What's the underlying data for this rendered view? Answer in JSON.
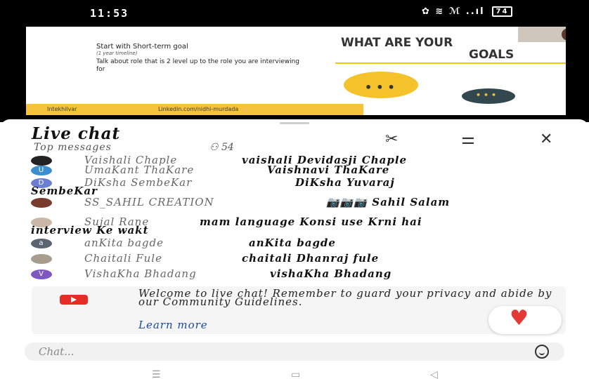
{
  "status_bar": {
    "time": "11:53",
    "icons": "✿ ≋ ℳ ..ıl",
    "battery": "74"
  },
  "slide": {
    "line1": "Start with Short-term goal",
    "line2": "(1 year timeline)",
    "line3": "Talk about role that is 2 level up to the role you are interviewing for",
    "title_line1": "WHAT ARE YOUR",
    "title_line2": "GOALS",
    "footer_left": "Intekhilvar",
    "footer_right": "Linkedin.com/nidhi-murdada"
  },
  "chat": {
    "title": "Live chat",
    "subtitle": "Top messages",
    "viewer_count": "54",
    "messages": [
      {
        "avatar": "",
        "avatar_color": "#222222",
        "author": "Vaishali Chaple",
        "text": "vaishali Devidasji Chaple",
        "text_left": 300
      },
      {
        "avatar": "U",
        "avatar_color": "#3b8ed0",
        "author": "UmaKant ThaKare",
        "text": "Vaishnavi ThaKare",
        "text_left": 336
      },
      {
        "avatar": "D",
        "avatar_color": "#6a7fd1",
        "author": "DiKsha SembeKar",
        "text": "DiKsha Yuvaraj SembeKar",
        "text_left": 376
      },
      {
        "avatar": "",
        "avatar_color": "#7a3b2e",
        "author": "SS_SAHIL CREATION",
        "text": "📷📷📷  Sahil Salam",
        "text_left": 420
      },
      {
        "avatar": "",
        "avatar_color": "#c9b8a8",
        "author": "Sujal Rane",
        "text": "mam language Konsi use Krni hai interview Ke wakt",
        "text_left": 240
      },
      {
        "avatar": "a",
        "avatar_color": "#5b6470",
        "author": "anKita bagde",
        "text": "anKita bagde",
        "text_left": 310
      },
      {
        "avatar": "",
        "avatar_color": "#a89c8e",
        "author": "Chaitali Fule",
        "text": "chaitali Dhanraj fule",
        "text_left": 300
      },
      {
        "avatar": "V",
        "avatar_color": "#7e57c2",
        "author": "VishaKha Bhadang",
        "text": "vishaKha Bhadang",
        "text_left": 340
      }
    ],
    "welcome": "Welcome to live chat! Remember to guard your privacy and abide by our Community Guidelines.",
    "learn_more": "Learn more",
    "input_placeholder": "Chat..."
  },
  "icons": {
    "scissors": "scissors-icon",
    "filter": "filter-icon",
    "close": "close-icon",
    "person": "person-icon",
    "heart": "heart-icon",
    "emoji": "emoji-icon"
  }
}
